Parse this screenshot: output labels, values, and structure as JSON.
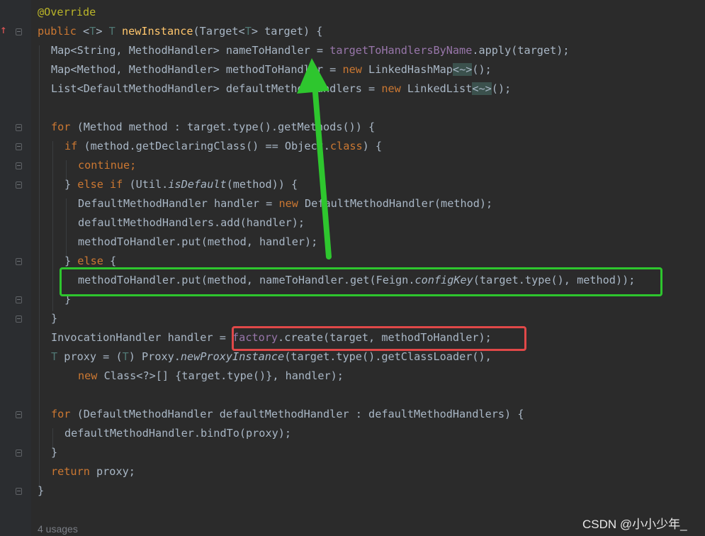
{
  "editor": {
    "lines": {
      "l0": {
        "a": "@Override"
      },
      "l1": {
        "a": "public ",
        "b": "<",
        "c": "T",
        "d": "> ",
        "e": "T",
        "f": " ",
        "g": "newInstance",
        "h": "(Target<",
        "i": "T",
        "j": "> target) {"
      },
      "l2": {
        "a": "Map<String, MethodHandler> nameToHandler = ",
        "b": "targetToHandlersByName",
        "c": ".apply(target);"
      },
      "l3": {
        "a": "Map<Method, MethodHandler> methodToHandler = ",
        "b": "new",
        "c": " LinkedHashMap",
        "d": "<~>",
        "e": "();"
      },
      "l4": {
        "a": "List<DefaultMethodHandler> defaultMethodHandlers = ",
        "b": "new",
        "c": " LinkedList",
        "d": "<~>",
        "e": "();"
      },
      "l5": {
        "a": "for",
        "b": " (Method method : target.type().getMethods()) {"
      },
      "l6": {
        "a": "if",
        "b": " (method.getDeclaringClass() == Object.",
        "c": "class",
        "d": ") {"
      },
      "l7": {
        "a": "continue;"
      },
      "l8": {
        "a": "} ",
        "b": "else if",
        "c": " (Util.",
        "d": "isDefault",
        "e": "(method)) {"
      },
      "l9": {
        "a": "DefaultMethodHandler handler = ",
        "b": "new",
        "c": " DefaultMethodHandler(method);"
      },
      "l10": {
        "a": "defaultMethodHandlers.add(handler);"
      },
      "l11": {
        "a": "methodToHandler.put(method, handler);"
      },
      "l12": {
        "a": "} ",
        "b": "else",
        "c": " {"
      },
      "l13": {
        "a": "methodToHandler.put(method, nameToHandler.get(Feign.",
        "b": "configKey",
        "c": "(target.type(), method));"
      },
      "l14": {
        "a": "}"
      },
      "l15": {
        "a": "}"
      },
      "l16": {
        "a": "InvocationHandler handler = ",
        "b": "factory",
        "c": ".create(target, methodToHandler);"
      },
      "l17": {
        "a": "T",
        "b": " proxy = (",
        "c": "T",
        "d": ") Proxy.",
        "e": "newProxyInstance",
        "f": "(target.type().getClassLoader(),"
      },
      "l18": {
        "a": "new",
        "b": " Class<?>[] {target.type()}, handler);"
      },
      "l19": {
        "a": "for",
        "b": " (DefaultMethodHandler defaultMethodHandler : defaultMethodHandlers) {"
      },
      "l20": {
        "a": "defaultMethodHandler.bindTo(proxy);"
      },
      "l21": {
        "a": "}"
      },
      "l22": {
        "a": "return",
        "b": " proxy;"
      },
      "l23": {
        "a": "}"
      }
    },
    "usages": "4 usages"
  },
  "gutter": {
    "implements_marker": "↑"
  },
  "watermark": "CSDN @小小少年_",
  "annotations": {
    "green_color": "#2ec62e",
    "red_color": "#e04848"
  }
}
